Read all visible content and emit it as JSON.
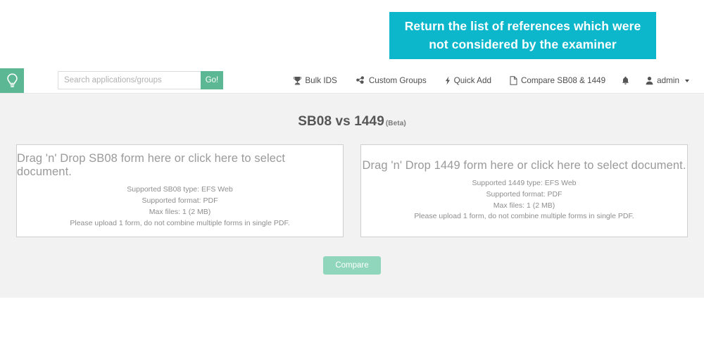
{
  "annotation": {
    "text": "Return the list of references which were not considered by the examiner",
    "background_color": "#0cb6cb",
    "text_color": "#ffffff"
  },
  "navbar": {
    "brand_icon": "lightbulb-icon",
    "brand_color": "#5cb894",
    "search": {
      "placeholder": "Search applications/groups",
      "value": "",
      "submit_label": "Go!"
    },
    "items": [
      {
        "label": "Bulk IDS",
        "icon": "trophy-icon"
      },
      {
        "label": "Custom Groups",
        "icon": "sitemap-icon"
      },
      {
        "label": "Quick Add",
        "icon": "lightning-bolt-icon"
      },
      {
        "label": "Compare SB08 & 1449",
        "icon": "file-document-icon"
      }
    ],
    "notifications_icon": "bell-icon",
    "user": {
      "icon": "user-icon",
      "label": "admin",
      "caret": "chevron-down-icon"
    }
  },
  "main": {
    "title": "SB08 vs 1449",
    "title_badge": "(Beta)",
    "background_color": "#f2f2f2",
    "dropzones": [
      {
        "prompt": "Drag 'n' Drop SB08 form here or click here to select document.",
        "lines": [
          "Supported SB08 type: EFS Web",
          "Supported format: PDF",
          "Max files: 1 (2 MB)",
          "Please upload 1 form, do not combine multiple forms in single PDF."
        ]
      },
      {
        "prompt": "Drag 'n' Drop 1449 form here or click here to select document.",
        "lines": [
          "Supported 1449 type: EFS Web",
          "Supported format: PDF",
          "Max files: 1 (2 MB)",
          "Please upload 1 form, do not combine multiple forms in single PDF."
        ]
      }
    ],
    "compare_button": {
      "label": "Compare",
      "color": "#8fd6bc",
      "enabled": false
    }
  }
}
